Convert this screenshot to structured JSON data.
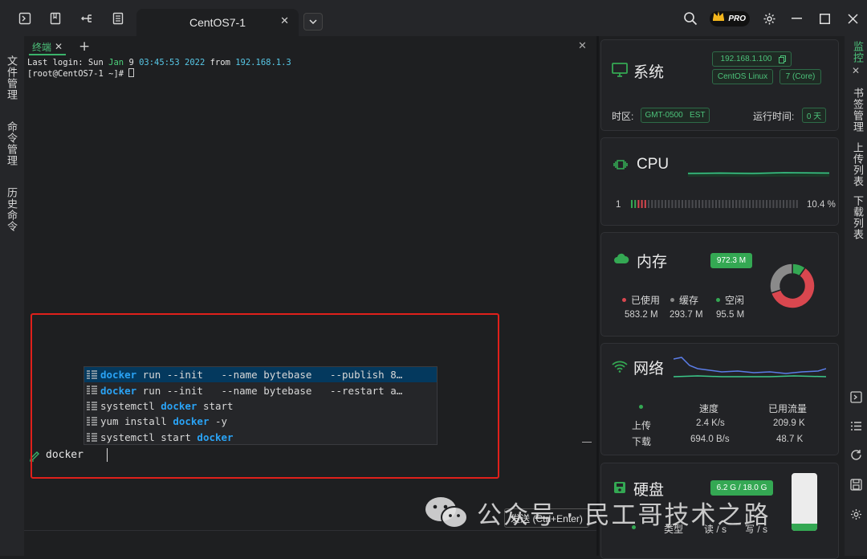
{
  "toolbar": {
    "icons": [
      "terminal-icon",
      "bookmark-icon",
      "split-icon",
      "list-icon"
    ],
    "session_tab_title": "CentOS7-1",
    "session_tab_close": "✕",
    "pro_label": "PRO"
  },
  "left_sidebar": {
    "items": [
      {
        "label": "文件管理"
      },
      {
        "label": "命令管理"
      },
      {
        "label": "历史命令"
      }
    ]
  },
  "terminal_tab": {
    "label": "终端",
    "close": "✕",
    "add": "+",
    "panel_close": "✕"
  },
  "terminal": {
    "login_prefix": "Last login: Sun ",
    "login_month": "Jan",
    "login_day": "  9 ",
    "login_time": "03:45:53",
    "login_year": " 2022 ",
    "login_from": "from ",
    "login_ip": "192.168.1.3",
    "prompt": "[root@CentOS7-1 ~]# "
  },
  "autocomplete": {
    "items": [
      {
        "pre": "",
        "hl": "docker",
        "post": " run --init   --name bytebase   --publish 8…"
      },
      {
        "pre": "",
        "hl": "docker",
        "post": " run --init   --name bytebase   --restart a…"
      },
      {
        "pre": "systemctl ",
        "hl": "docker",
        "post": " start"
      },
      {
        "pre": "yum install ",
        "hl": "docker",
        "post": " -y"
      },
      {
        "pre": "systemctl start ",
        "hl": "docker",
        "post": ""
      }
    ]
  },
  "command_input": {
    "value": "docker",
    "send_label": "发送 (Ctrl+Enter)"
  },
  "watermark": {
    "text": "公众号 · 民工哥技术之路"
  },
  "monitor": {
    "system": {
      "title": "系统",
      "ip": "192.168.1.100",
      "os": "CentOS Linux",
      "version": "7 (Core)",
      "timezone_label": "时区:",
      "timezone": "GMT-0500   EST",
      "uptime_label": "运行时间:",
      "uptime": "0 天"
    },
    "cpu": {
      "title": "CPU",
      "core": "1",
      "usage": "10.4 %",
      "usage_fraction": 0.104
    },
    "memory": {
      "title": "内存",
      "total": "972.3 M",
      "used_label": "已使用",
      "cache_label": "缓存",
      "free_label": "空闲",
      "used": "583.2 M",
      "cache": "293.7 M",
      "free": "95.5 M",
      "colors": {
        "used": "#d9474f",
        "cache": "#8a8a8a",
        "free": "#34a853"
      }
    },
    "network": {
      "title": "网络",
      "speed_header": "速度",
      "traffic_header": "已用流量",
      "upload_label": "上传",
      "download_label": "下载",
      "upload_speed": "2.4 K/s",
      "upload_traffic": "209.9 K",
      "download_speed": "694.0 B/s",
      "download_traffic": "48.7 K"
    },
    "disk": {
      "title": "硬盘",
      "usage": "6.2 G / 18.0 G",
      "col_type": "类型",
      "col_read": "读 / s",
      "col_write": "写 / s"
    }
  },
  "right_sidebar": {
    "items": [
      {
        "label": "监控"
      },
      {
        "label": "书签管理"
      },
      {
        "label": "上传列表"
      },
      {
        "label": "下载列表"
      }
    ]
  },
  "colors": {
    "accent": "#4cc27a",
    "highlight": "#2aa3f5",
    "annotation": "#e0201b"
  }
}
